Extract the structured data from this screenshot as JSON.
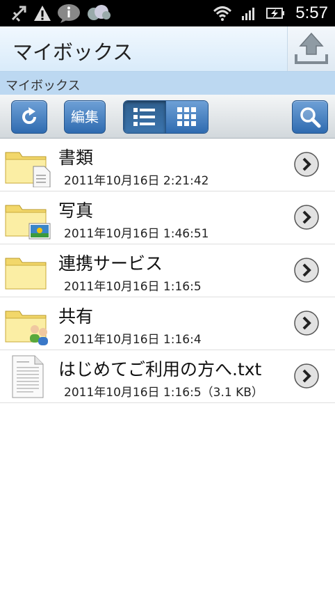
{
  "status_bar": {
    "time": "5:57",
    "icons": [
      "usb-debug-icon",
      "warning-icon",
      "info-bubble-icon",
      "sync-cloud-icon",
      "wifi-icon",
      "signal-icon",
      "battery-charging-icon"
    ]
  },
  "header": {
    "title": "マイボックス",
    "upload_icon": "upload-icon"
  },
  "breadcrumb": {
    "path": "マイボックス"
  },
  "toolbar": {
    "refresh_icon": "refresh-icon",
    "edit_label": "編集",
    "list_view_icon": "list-view-icon",
    "grid_view_icon": "grid-view-icon",
    "search_icon": "search-icon",
    "active_view": "list"
  },
  "files": [
    {
      "name": "書類",
      "meta": "2011年10月16日 2:21:42",
      "icon": "folder-documents-icon"
    },
    {
      "name": "写真",
      "meta": "2011年10月16日 1:46:51",
      "icon": "folder-photos-icon"
    },
    {
      "name": "連携サービス",
      "meta": "2011年10月16日 1:16:5",
      "icon": "folder-icon"
    },
    {
      "name": "共有",
      "meta": "2011年10月16日 1:16:4",
      "icon": "folder-shared-icon"
    },
    {
      "name": "はじめてご利用の方へ.txt",
      "meta": "2011年10月16日 1:16:5（3.1 KB）",
      "icon": "text-file-icon"
    }
  ],
  "colors": {
    "accent": "#2f6bb0",
    "breadcrumb_bg": "#bcd8f1",
    "titlebar_bg": "#e6f1fb"
  }
}
